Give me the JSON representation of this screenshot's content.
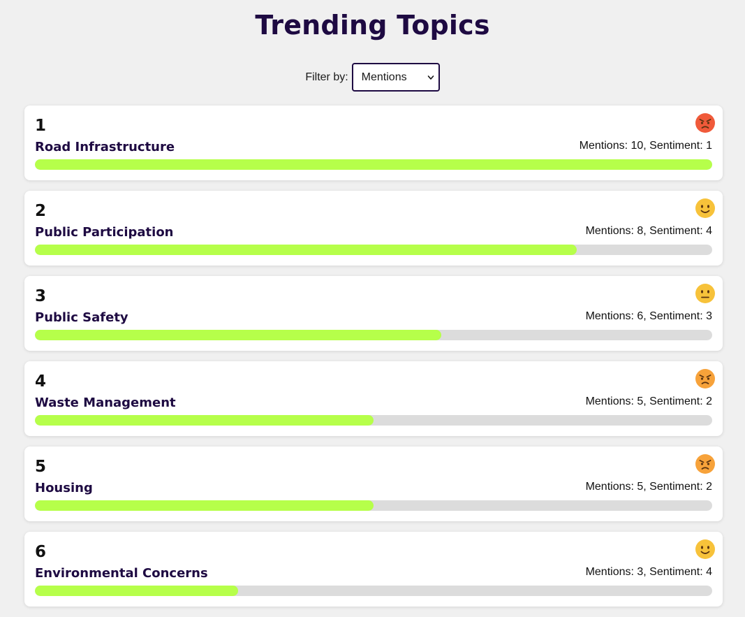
{
  "header": {
    "title": "Trending Topics"
  },
  "filter": {
    "label": "Filter by:",
    "selected": "Mentions"
  },
  "colors": {
    "title": "#1e0a42",
    "bar_fill": "#b6ff4a",
    "bar_track": "#dcdcdc",
    "page_bg": "#f0f0f0"
  },
  "topics": [
    {
      "rank": "1",
      "name": "Road Infrastructure",
      "stats": "Mentions: 10, Sentiment: 1",
      "mentions": 10,
      "sentiment": 1,
      "emoji": "angry-face-icon",
      "emoji_color": "#f05a3a"
    },
    {
      "rank": "2",
      "name": "Public Participation",
      "stats": "Mentions: 8, Sentiment: 4",
      "mentions": 8,
      "sentiment": 4,
      "emoji": "slightly-smiling-face-icon",
      "emoji_color": "#f7c23a"
    },
    {
      "rank": "3",
      "name": "Public Safety",
      "stats": "Mentions: 6, Sentiment: 3",
      "mentions": 6,
      "sentiment": 3,
      "emoji": "neutral-face-icon",
      "emoji_color": "#f7c23a"
    },
    {
      "rank": "4",
      "name": "Waste Management",
      "stats": "Mentions: 5, Sentiment: 2",
      "mentions": 5,
      "sentiment": 2,
      "emoji": "pouting-face-icon",
      "emoji_color": "#f7a23a"
    },
    {
      "rank": "5",
      "name": "Housing",
      "stats": "Mentions: 5, Sentiment: 2",
      "mentions": 5,
      "sentiment": 2,
      "emoji": "pouting-face-icon",
      "emoji_color": "#f7a23a"
    },
    {
      "rank": "6",
      "name": "Environmental Concerns",
      "stats": "Mentions: 3, Sentiment: 4",
      "mentions": 3,
      "sentiment": 4,
      "emoji": "slightly-smiling-face-icon",
      "emoji_color": "#f7c23a"
    }
  ],
  "max_mentions": 10
}
